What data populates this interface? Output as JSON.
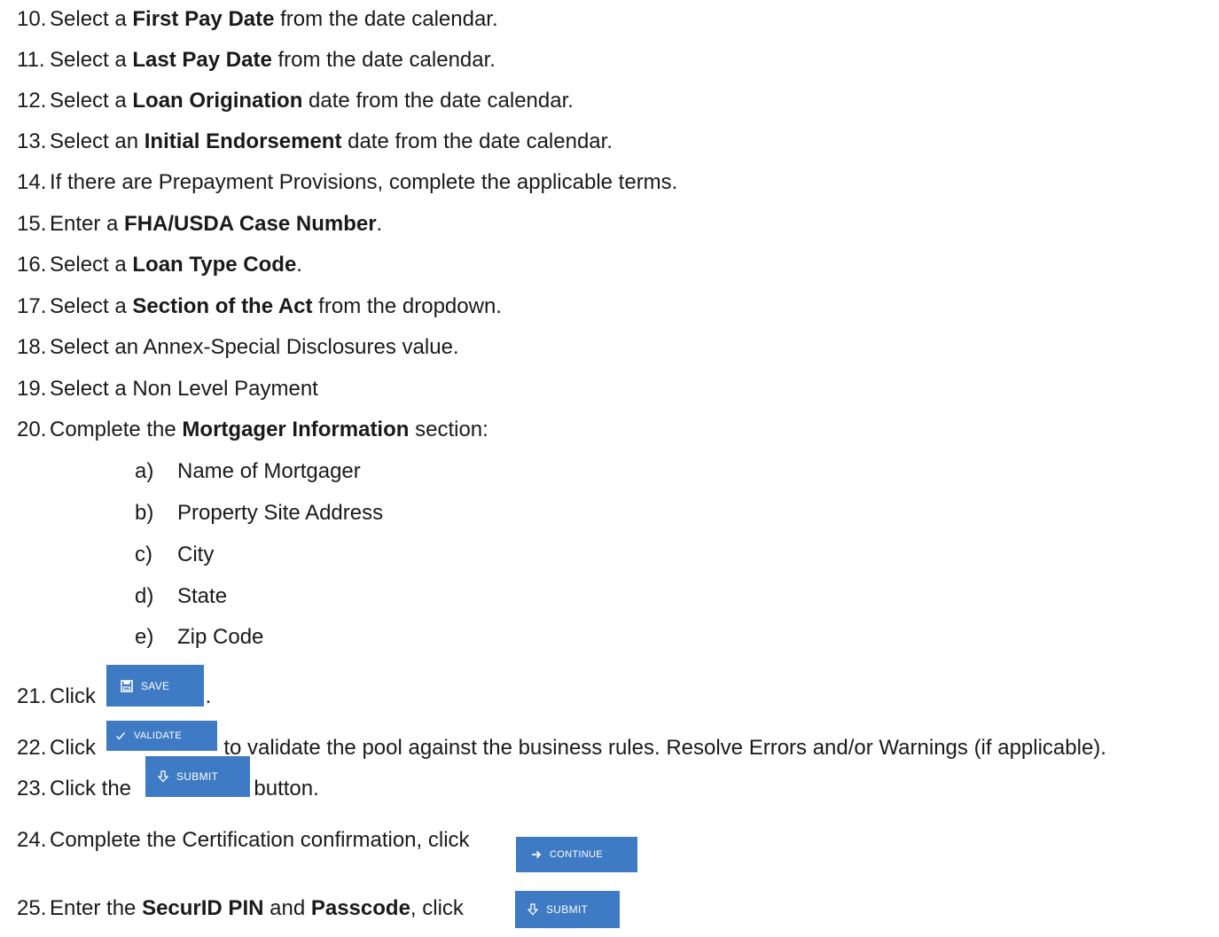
{
  "steps": [
    {
      "num": "10.",
      "pre": "Select a ",
      "bold": "First Pay Date",
      "post": " from the date calendar."
    },
    {
      "num": "11.",
      "pre": "Select a ",
      "bold": "Last Pay Date",
      "post": " from the date calendar."
    },
    {
      "num": "12.",
      "pre": "Select a ",
      "bold": "Loan Origination",
      "post": " date from the date calendar."
    },
    {
      "num": "13.",
      "pre": "Select an ",
      "bold": "Initial Endorsement",
      "post": " date from the date calendar."
    },
    {
      "num": "14.",
      "text": "If there are Prepayment Provisions, complete the applicable terms."
    },
    {
      "num": "15.",
      "pre": "Enter a ",
      "bold": "FHA/USDA Case Number",
      "post": "."
    },
    {
      "num": "16.",
      "pre": "Select a ",
      "bold": "Loan Type Code",
      "post": "."
    },
    {
      "num": "17.",
      "pre": "Select a ",
      "bold": "Section of the Act",
      "post": " from the dropdown."
    },
    {
      "num": "18.",
      "text": "Select an Annex-Special Disclosures value."
    },
    {
      "num": "19.",
      "text": "Select a Non Level Payment"
    },
    {
      "num": "20.",
      "pre": "Complete the ",
      "bold": "Mortgager Information",
      "post": " section:"
    },
    {
      "num": "21.",
      "pre": "Click ",
      "post": "."
    },
    {
      "num": "22.",
      "pre": "Click ",
      "post": " to validate the pool against the business rules. Resolve Errors and/or Warnings (if applicable)."
    },
    {
      "num": "23.",
      "pre": "Click the ",
      "post": " button."
    },
    {
      "num": "24.",
      "pre": "Complete the Certification confirmation, click",
      "post": "."
    },
    {
      "num": "25.",
      "pre": "Enter the ",
      "bold": "SecurID PIN",
      "mid": " and ",
      "bold2": "Passcode",
      "pre2": ", click ",
      "post": "."
    }
  ],
  "mortgager_items": [
    {
      "letter": "a)",
      "text": "Name of Mortgager"
    },
    {
      "letter": "b)",
      "text": "Property Site Address"
    },
    {
      "letter": "c)",
      "text": "City"
    },
    {
      "letter": "d)",
      "text": "State"
    },
    {
      "letter": "e)",
      "text": "Zip Code"
    }
  ],
  "buttons": {
    "save": {
      "label": "SAVE",
      "icon": "floppy-disk-icon"
    },
    "validate": {
      "label": "VALIDATE",
      "icon": "checkmark-icon"
    },
    "submit": {
      "label": "SUBMIT",
      "icon": "down-arrow-icon"
    },
    "continue": {
      "label": "CONTINUE",
      "icon": "right-arrow-icon"
    },
    "submit2": {
      "label": "SUBMIT",
      "icon": "down-arrow-icon"
    }
  },
  "colors": {
    "button_bg": "#3f7bc4",
    "button_text": "#ffffff",
    "text": "#1a1a1a"
  }
}
